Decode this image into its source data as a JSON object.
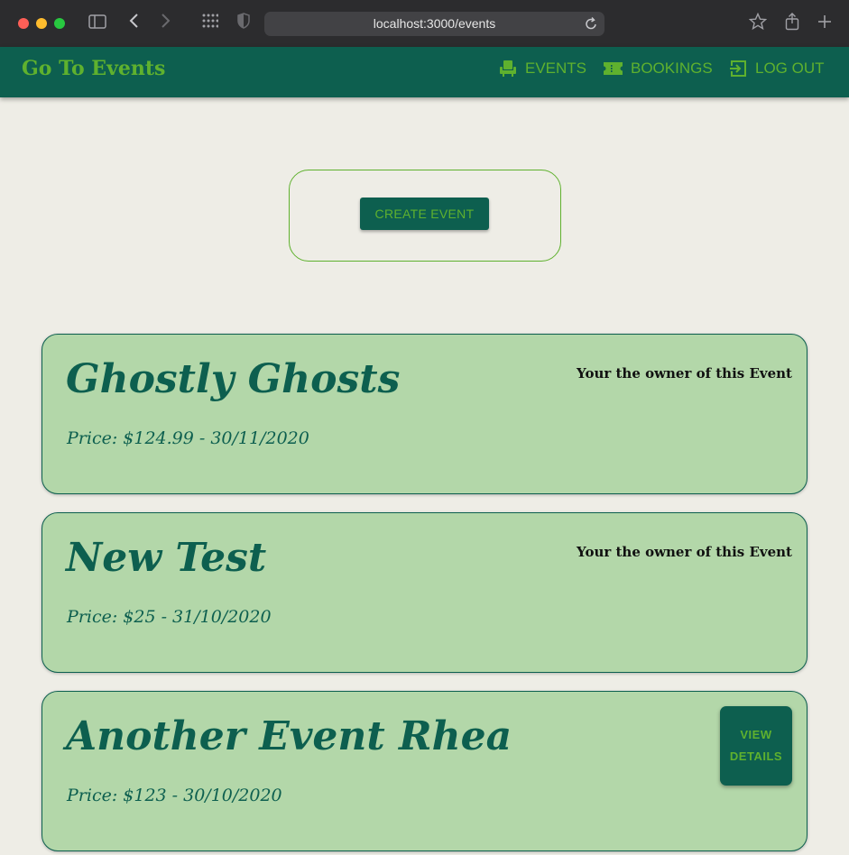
{
  "browser": {
    "url": "localhost:3000/events"
  },
  "navbar": {
    "brand": "Go To Events",
    "items": [
      {
        "label": "EVENTS",
        "icon": "armchair-icon"
      },
      {
        "label": "BOOKINGS",
        "icon": "ticket-icon"
      },
      {
        "label": "LOG OUT",
        "icon": "logout-icon"
      }
    ]
  },
  "create": {
    "button_label": "CREATE EVENT"
  },
  "events": [
    {
      "title": "Ghostly Ghosts",
      "price_line": "Price: $124.99 - 30/11/2020",
      "owner_note": "Your the owner of this Event"
    },
    {
      "title": "New Test",
      "price_line": "Price: $25 - 31/10/2020",
      "owner_note": "Your the owner of this Event"
    },
    {
      "title": "Another Event Rhea",
      "price_line": "Price: $123 - 30/10/2020",
      "action_label": "VIEW DETAILS"
    }
  ],
  "colors": {
    "primary": "#0d5f4f",
    "accent": "#5fb12e",
    "card_bg": "#b3d7a9",
    "page_bg": "#eeede6"
  }
}
